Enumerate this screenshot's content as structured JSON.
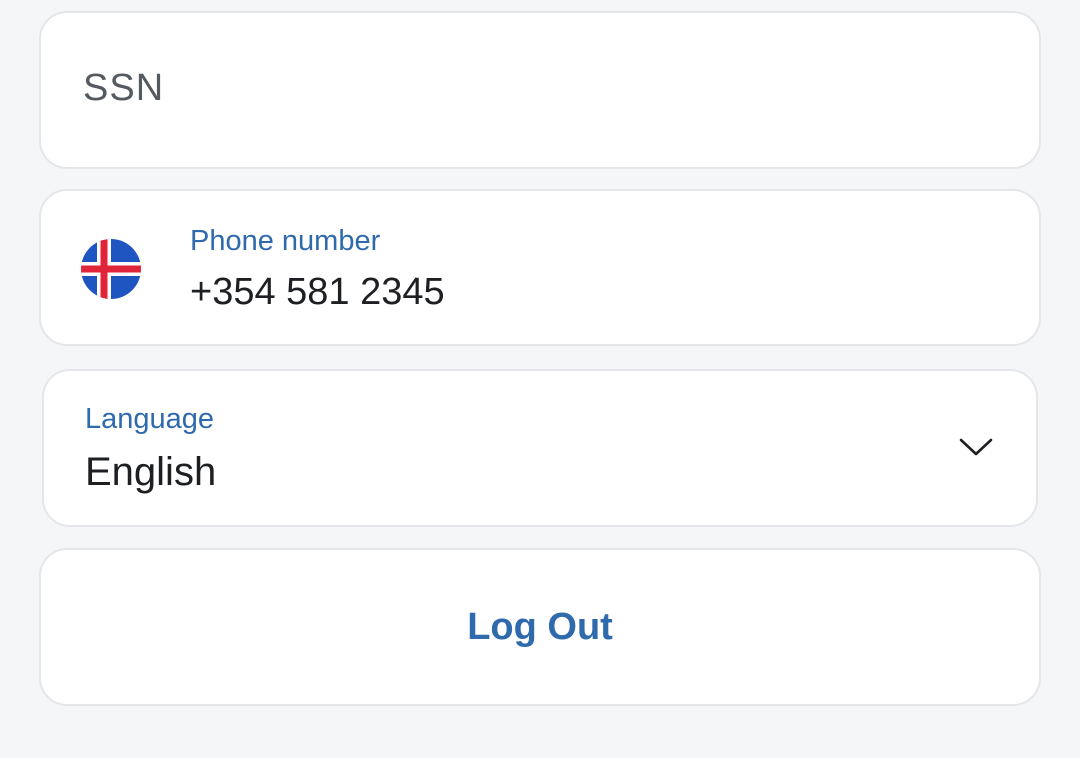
{
  "ssn": {
    "placeholder": "SSN"
  },
  "phone": {
    "label": "Phone number",
    "value": "+354 581 2345",
    "flag_icon": "iceland-flag-icon"
  },
  "language": {
    "label": "Language",
    "value": "English",
    "dropdown_icon": "chevron-down-icon"
  },
  "logout": {
    "label": "Log Out"
  },
  "colors": {
    "background": "#f5f6f8",
    "card": "#ffffff",
    "accent": "#2f6aad",
    "text": "#1d1f22",
    "placeholder": "#555a60"
  }
}
